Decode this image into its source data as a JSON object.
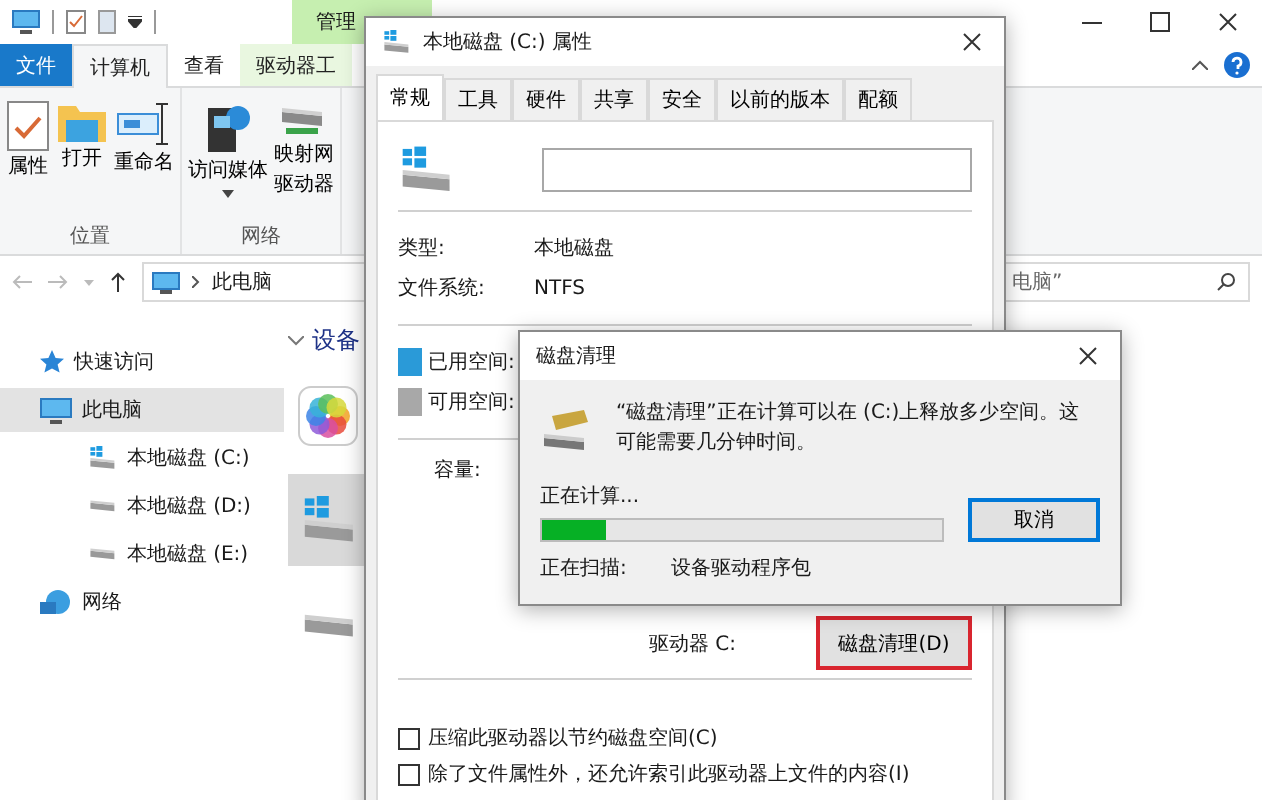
{
  "explorer": {
    "context_tab": "管理",
    "tabs": [
      {
        "label": "文件",
        "kind": "file",
        "selected": false
      },
      {
        "label": "计算机",
        "kind": "tab",
        "selected": true
      },
      {
        "label": "查看",
        "kind": "tab",
        "selected": false
      },
      {
        "label": "驱动器工",
        "kind": "context",
        "selected": false
      }
    ],
    "ribbon_groups": [
      {
        "label": "位置",
        "buttons": [
          {
            "kind": "properties",
            "lines": [
              "属性"
            ]
          },
          {
            "kind": "folder",
            "lines": [
              "打开"
            ]
          },
          {
            "kind": "rename",
            "lines": [
              "重命名"
            ]
          }
        ]
      },
      {
        "label": "网络",
        "buttons": [
          {
            "kind": "media",
            "lines": [
              "访问媒体"
            ],
            "dropdown": true
          },
          {
            "kind": "network-drive",
            "lines": [
              "映射网",
              "驱动器"
            ]
          }
        ]
      }
    ],
    "address": {
      "path": "此电脑"
    },
    "search": {
      "placeholder": "电脑”"
    },
    "nav": [
      {
        "label": "快速访问",
        "kind": "star",
        "selected": false
      },
      {
        "label": "此电脑",
        "kind": "pc",
        "selected": true,
        "children": [
          {
            "label": "本地磁盘 (C:)",
            "kind": "system-drive",
            "selected": false
          },
          {
            "label": "本地磁盘 (D:)",
            "kind": "drive",
            "selected": false
          },
          {
            "label": "本地磁盘 (E:)",
            "kind": "drive",
            "selected": false
          }
        ]
      },
      {
        "label": "网络",
        "kind": "network",
        "selected": false
      }
    ],
    "section": "设备",
    "items": [
      {
        "kind": "photos",
        "selected": false
      },
      {
        "kind": "system-drive",
        "selected": true
      },
      {
        "kind": "drive",
        "selected": false
      }
    ]
  },
  "properties": {
    "title": "本地磁盘 (C:) 属性",
    "tabs": [
      {
        "label": "常规",
        "selected": true
      },
      {
        "label": "工具",
        "selected": false
      },
      {
        "label": "硬件",
        "selected": false
      },
      {
        "label": "共享",
        "selected": false
      },
      {
        "label": "安全",
        "selected": false
      },
      {
        "label": "以前的版本",
        "selected": false
      },
      {
        "label": "配额",
        "selected": false
      }
    ],
    "info": [
      {
        "label": "类型:",
        "value": "本地磁盘"
      },
      {
        "label": "文件系统:",
        "value": "NTFS"
      }
    ],
    "space": [
      {
        "label": "已用空间:",
        "color": "#2a9ad8"
      },
      {
        "label": "可用空间:",
        "color": "#a8a8a8"
      }
    ],
    "capacity_label": "容量:",
    "drive_label": "驱动器 C:",
    "cleanup_button": {
      "label": "磁盘清理(D)",
      "highlighted": true
    },
    "options": [
      {
        "label": "压缩此驱动器以节约磁盘空间(C)",
        "checked": false
      },
      {
        "label": "除了文件属性外，还允许索引此驱动器上文件的内容(I)",
        "checked": false
      }
    ]
  },
  "cleanup": {
    "title": "磁盘清理",
    "message": "“磁盘清理”正在计算可以在 (C:)上释放多少空间。这可能需要几分钟时间。",
    "status": "正在计算...",
    "progress": {
      "level": 0.16
    },
    "cancel": "取消",
    "scan_label": "正在扫描:",
    "scan_item": "设备驱动程序包"
  }
}
